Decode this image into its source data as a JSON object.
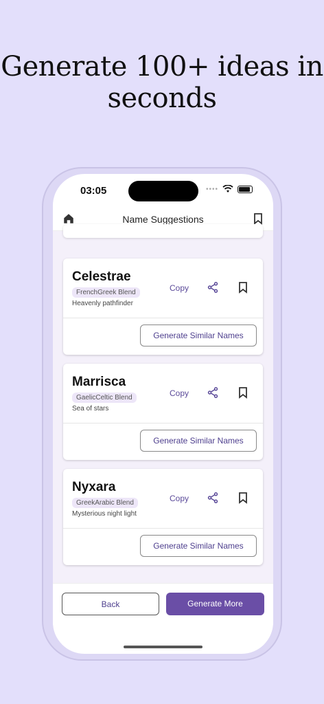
{
  "headline": "Generate 100+ ideas in seconds",
  "status_bar": {
    "time": "03:05"
  },
  "appbar": {
    "title": "Name Suggestions"
  },
  "cards": [
    {
      "name": "Celestrae",
      "tag": "FrenchGreek Blend",
      "meaning": "Heavenly pathfinder",
      "copy_label": "Copy",
      "similar_label": "Generate Similar Names"
    },
    {
      "name": "Marrisca",
      "tag": "GaelicCeltic Blend",
      "meaning": "Sea of stars",
      "copy_label": "Copy",
      "similar_label": "Generate Similar Names"
    },
    {
      "name": "Nyxara",
      "tag": "GreekArabic Blend",
      "meaning": "Mysterious night light",
      "copy_label": "Copy",
      "similar_label": "Generate Similar Names"
    }
  ],
  "bottom": {
    "back_label": "Back",
    "generate_more_label": "Generate More"
  },
  "colors": {
    "accent": "#6a4ea6",
    "background": "#e3dffb",
    "tag_bg": "#ede6f8"
  },
  "icons": [
    "home-icon",
    "bookmark-icon",
    "share-icon",
    "wifi-icon",
    "battery-icon"
  ]
}
